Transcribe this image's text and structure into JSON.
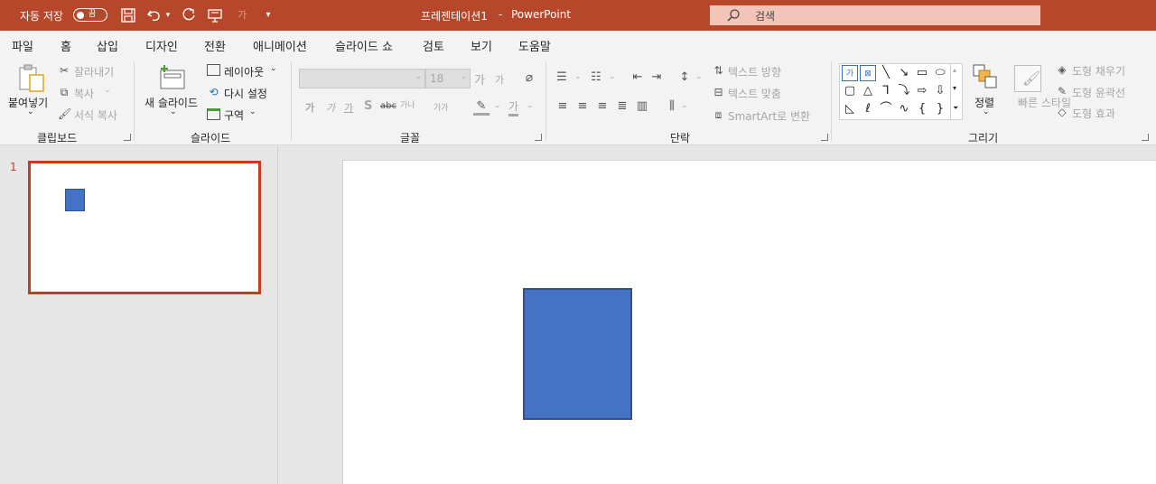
{
  "titlebar": {
    "autosave_label": "자동 저장",
    "autosave_state": "끔",
    "title": "프레젠테이션1",
    "separator": "-",
    "app_name": "PowerPoint",
    "search_placeholder": "검색",
    "bg_color": "#b7472a",
    "qat_icons": [
      "save-icon",
      "undo-icon",
      "redo-icon",
      "start-from-beginning-icon",
      "font-color-icon",
      "customize-qat-icon"
    ]
  },
  "tabs": [
    {
      "label": "파일"
    },
    {
      "label": "홈",
      "active": true
    },
    {
      "label": "삽입"
    },
    {
      "label": "디자인"
    },
    {
      "label": "전환"
    },
    {
      "label": "애니메이션"
    },
    {
      "label": "슬라이드 쇼"
    },
    {
      "label": "검토"
    },
    {
      "label": "보기"
    },
    {
      "label": "도움말"
    }
  ],
  "ribbon": {
    "clipboard": {
      "group_label": "클립보드",
      "paste": "붙여넣기",
      "cut": "잘라내기",
      "copy": "복사",
      "format_painter": "서식 복사"
    },
    "slides": {
      "group_label": "슬라이드",
      "new_slide": "새 슬라이드",
      "layout": "레이아웃",
      "reset": "다시 설정",
      "section": "구역"
    },
    "font": {
      "group_label": "글꼴",
      "font_name": "",
      "font_size": "18",
      "grow": "가",
      "shrink": "가",
      "bold": "가",
      "italic": "가",
      "underline": "가",
      "strike": "S",
      "spacing": "가나",
      "case": "가가",
      "font_color": "가"
    },
    "paragraph": {
      "group_label": "단락",
      "text_direction": "텍스트 방향",
      "align_text": "텍스트 맞춤",
      "smartart": "SmartArt로 변환"
    },
    "drawing": {
      "group_label": "그리기",
      "arrange": "정렬",
      "quick_styles": "빠른 스타일",
      "shape_fill": "도형 채우기",
      "shape_outline": "도형 윤곽선",
      "shape_effects": "도형 효과",
      "text_box_glyph": "가",
      "brace_open": "{",
      "brace_close": "}"
    }
  },
  "slides_pane": {
    "slides": [
      {
        "number": "1"
      }
    ]
  },
  "colors": {
    "accent": "#c43e1c",
    "shape_fill": "#4472c4",
    "shape_border": "#2f528f"
  }
}
